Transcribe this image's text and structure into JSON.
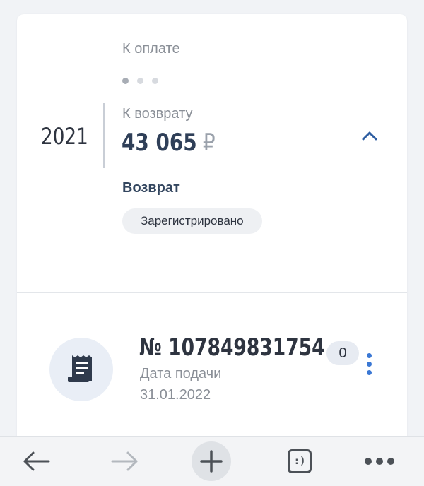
{
  "colors": {
    "accent": "#3b78d4",
    "text_dark": "#2e3440",
    "text_gray": "#8a8f97",
    "card_bg": "#ffffff",
    "page_bg": "#f1f3f6"
  },
  "declaration": {
    "year": "2021",
    "to_pay_label": "К оплате",
    "pager": {
      "count": 3,
      "active": 0
    },
    "refund_label": "К возврату",
    "refund_amount": "43 065",
    "currency": "₽",
    "expand_icon": "chevron-up-icon",
    "type_label": "Возврат",
    "status": "Зарегистрировано"
  },
  "document": {
    "icon": "receipt-icon",
    "number": "№ 107849831754",
    "date_label": "Дата подачи",
    "date": "31.01.2022",
    "badge_count": "0",
    "menu_icon": "kebab-menu-icon"
  },
  "browser_toolbar": {
    "back_icon": "arrow-left-icon",
    "forward_icon": "arrow-right-icon",
    "new_tab_icon": "plus-icon",
    "tabs_icon": "tabs-smiley-icon",
    "tabs_label": ":)",
    "menu_icon": "more-dots-icon"
  }
}
